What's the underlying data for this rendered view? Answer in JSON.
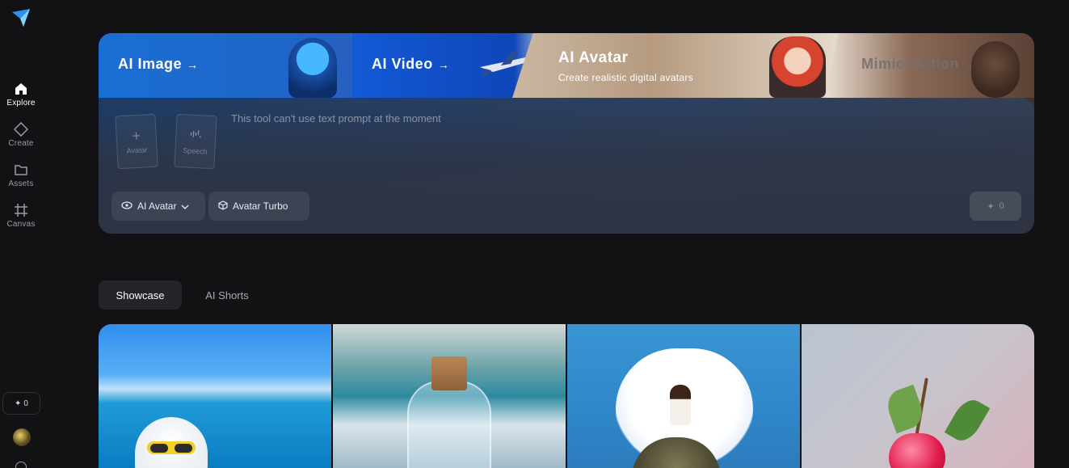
{
  "sidebar": {
    "items": [
      {
        "label": "Explore",
        "icon": "home-icon",
        "active": true
      },
      {
        "label": "Create",
        "icon": "diamond-icon",
        "active": false
      },
      {
        "label": "Assets",
        "icon": "folder-icon",
        "active": false
      },
      {
        "label": "Canvas",
        "icon": "frame-icon",
        "active": false
      }
    ],
    "credits": "0"
  },
  "hero": {
    "tabs": [
      {
        "title": "AI Image",
        "arrow": "→"
      },
      {
        "title": "AI Video",
        "arrow": "→"
      },
      {
        "title": "AI Avatar",
        "subtitle": "Create realistic digital avatars"
      },
      {
        "title": "Mimic Motion",
        "arrow": "→"
      }
    ],
    "slots": [
      {
        "icon": "+",
        "label": "Avatar"
      },
      {
        "icon": "speech-icon",
        "label": "Speech"
      }
    ],
    "prompt_text": "This tool can't use text prompt at the moment",
    "model_chip": "AI Avatar",
    "turbo_chip": "Avatar Turbo",
    "generate_cost": "0"
  },
  "content_tabs": [
    {
      "label": "Showcase",
      "active": true
    },
    {
      "label": "AI Shorts",
      "active": false
    }
  ],
  "colors": {
    "background": "#121215",
    "panel": "#2e3443",
    "active_tab_bg": "#24242a",
    "muted_text": "#9a9aa3"
  }
}
